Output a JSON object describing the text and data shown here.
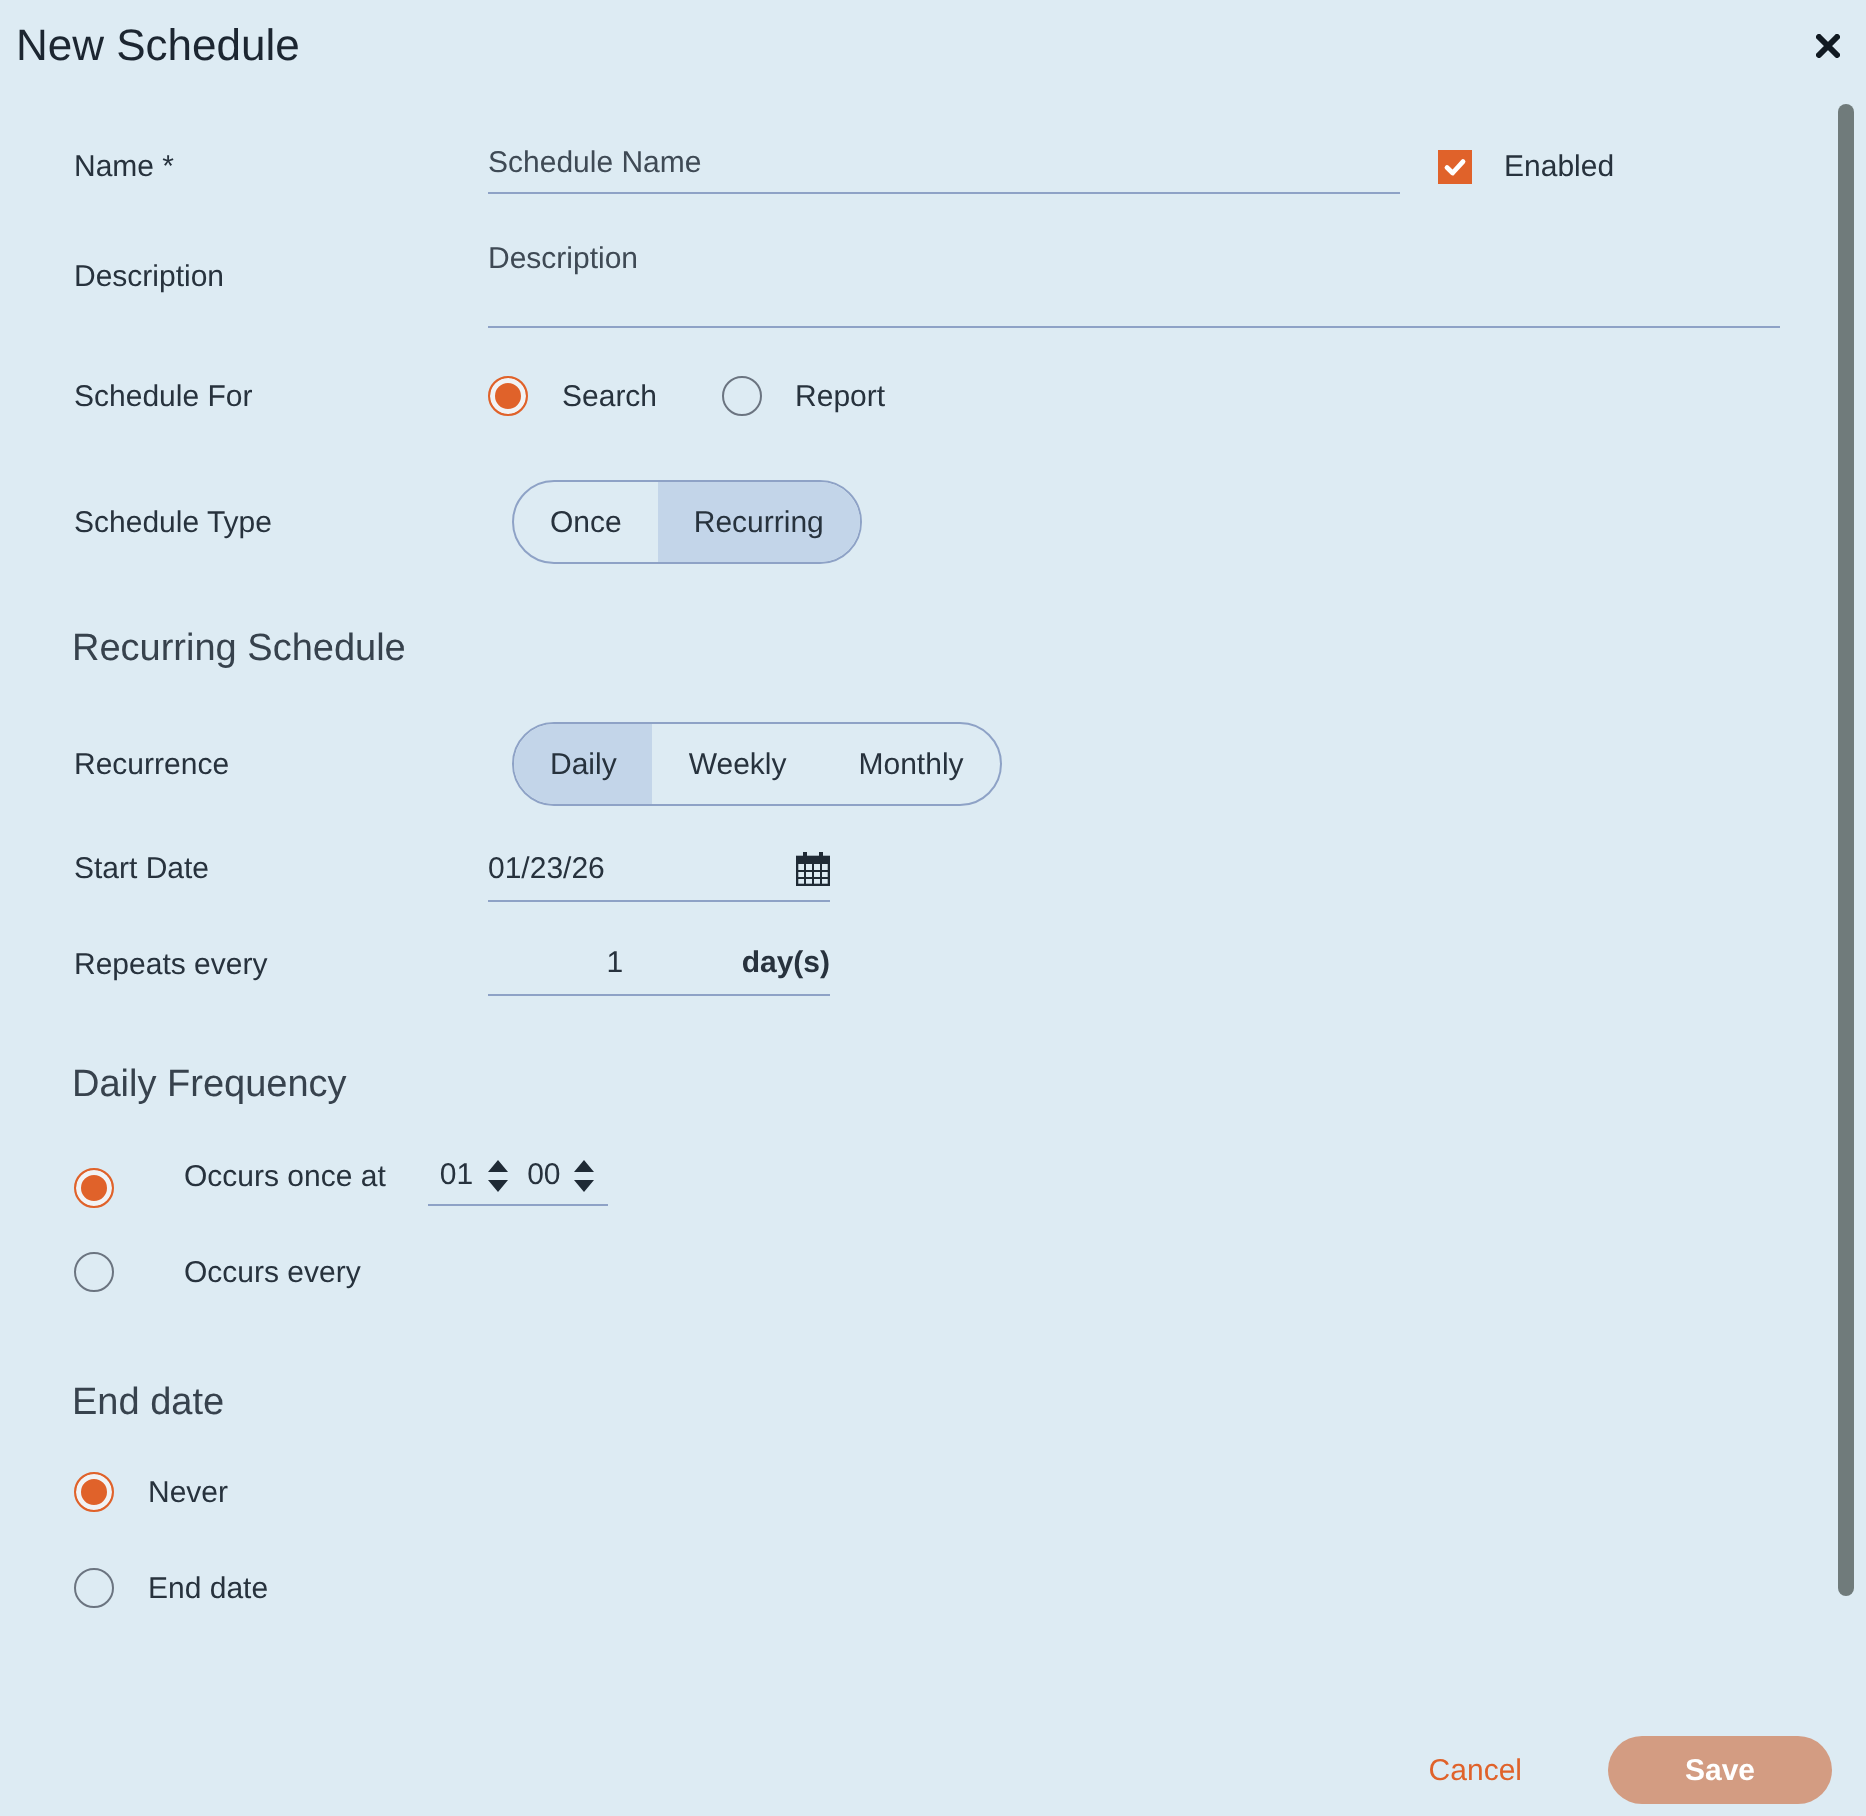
{
  "dialog": {
    "title": "New Schedule"
  },
  "general": {
    "name": {
      "label": "Name *",
      "placeholder": "Schedule Name"
    },
    "enabled": {
      "label": "Enabled",
      "checked": true
    },
    "description": {
      "label": "Description",
      "placeholder": "Description"
    },
    "schedule_for": {
      "label": "Schedule For",
      "options": [
        {
          "label": "Search",
          "selected": true
        },
        {
          "label": "Report",
          "selected": false
        }
      ]
    },
    "schedule_type": {
      "label": "Schedule Type",
      "options": [
        {
          "label": "Once",
          "selected": false
        },
        {
          "label": "Recurring",
          "selected": true
        }
      ]
    }
  },
  "recurring_schedule": {
    "heading": "Recurring Schedule",
    "recurrence": {
      "label": "Recurrence",
      "options": [
        {
          "label": "Daily",
          "selected": true
        },
        {
          "label": "Weekly",
          "selected": false
        },
        {
          "label": "Monthly",
          "selected": false
        }
      ]
    },
    "start_date": {
      "label": "Start Date",
      "value": "01/23/26"
    },
    "repeats_every": {
      "label": "Repeats every",
      "value": "1",
      "unit": "day(s)"
    }
  },
  "daily_frequency": {
    "heading": "Daily Frequency",
    "options": [
      {
        "kind": "time",
        "label": "Occurs once at",
        "selected": true,
        "hour": "01",
        "minute": "00"
      },
      {
        "kind": "plain",
        "label": "Occurs every",
        "selected": false
      }
    ]
  },
  "end_date": {
    "heading": "End date",
    "options": [
      {
        "label": "Never",
        "selected": true
      },
      {
        "label": "End date",
        "selected": false
      }
    ]
  },
  "footer": {
    "buttons": [
      {
        "kind": "link",
        "label": "Cancel",
        "disabled": false
      },
      {
        "kind": "primary",
        "label": "Save",
        "disabled": true
      }
    ]
  }
}
